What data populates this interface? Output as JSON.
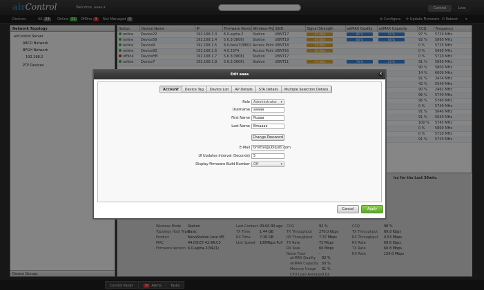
{
  "app": {
    "logo_prefix": "air",
    "logo_suffix": "Control",
    "welcome": "Welcome, aaaa ▾"
  },
  "top_buttons": {
    "control": "Control",
    "live": "Live"
  },
  "status": {
    "devices": "Devices",
    "all_label": "All",
    "all_count": "24",
    "online_label": "Online",
    "online_count": "21",
    "offline_label": "Offline",
    "offline_count": "3",
    "notmanaged_label": "Not Managed",
    "notmanaged_count": "0",
    "configure": "Configure",
    "update_firmware": "Update Firmware",
    "reboot": "Reboot",
    "more": "▾"
  },
  "colors": {
    "online": "#3aaa35",
    "offline": "#c22",
    "accent": "#1d7ab8",
    "apply": "#5ca52a"
  },
  "left": {
    "title": "Network Topology",
    "tree": [
      "airControl Server",
      "ABCD Network",
      "BFGH Network",
      "192.168.2",
      "PTP Devices"
    ],
    "footer": "Device Groups"
  },
  "grid": {
    "columns": [
      "Status",
      "Device Name",
      "IP",
      "Firmware Version",
      "Wireless Mode",
      "SSID",
      "Signal Strength",
      "airMAX Quality",
      "airMAX Capacity",
      "CCQ",
      "Frequency"
    ],
    "rows": [
      [
        "online",
        "Device22",
        "192.168.1.3",
        "6.0-alpha.2",
        "Station",
        "UBNT17",
        "-53 dBm",
        "85 %",
        "52 %",
        "97 %",
        "5720 MHz"
      ],
      [
        "online",
        "Device59",
        "192.168.1.4",
        "5.6.3(3808)",
        "Station",
        "UBNT19",
        "-67 dBm",
        "84 %",
        "86 %",
        "92 %",
        "5860 MHz"
      ],
      [
        "online",
        "DeviceR",
        "192.168.1.5",
        "6.0-beta7(3860)",
        "Access Point",
        "UBNT18",
        "-58 dBm",
        "",
        "",
        "0 %",
        "5725 MHz"
      ],
      [
        "online",
        "Device92",
        "192.168.1.6",
        "4.0.3374",
        "Access Point",
        "UBNT16",
        "-62 dBm",
        "",
        "",
        "0 %",
        "5660 MHz"
      ],
      [
        "offline",
        "DeviceHB",
        "192.168.1.7",
        "5.6.3(3808)",
        "Station",
        "UBNT17",
        "",
        "",
        "",
        "0 %",
        "5720 MHz"
      ],
      [
        "online",
        "Device7",
        "192.168.1.8",
        "5.6.2(3808)",
        "Station",
        "UBNT11",
        "-47 dBm",
        "74 %",
        "52 %",
        "91 %",
        "5860 MHz"
      ]
    ],
    "extra_ccq": [
      "90 %",
      "14 %",
      "91 %",
      "42 %",
      "90 %",
      "96 %",
      "96 %",
      "0 %",
      "91 %",
      "91 %",
      "100 %",
      "0 %",
      "0 %",
      "91 %"
    ],
    "extra_freq": [
      "5800 MHz",
      "6000 MHz",
      "2474 MHz",
      "5540 MHz",
      "2462 MHz",
      "5740 MHz",
      "5740 MHz",
      "5740 MHz",
      "5640 MHz",
      "5640 MHz",
      "5745 MHz",
      "5800 MHz",
      "5720 MHz",
      "5720 MHz"
    ]
  },
  "detail": {
    "chart_title": "ics for the Last 30min.",
    "left_labels": [
      "Wireless Mode",
      "Topology Host Type",
      "Product",
      "MAC",
      "Firmware Version"
    ],
    "left_values": [
      "Station",
      "Basic",
      "NanoStation Loco M5",
      "44:D9:E7:42:9A:C3",
      "6.0-alpha.2(3421)"
    ],
    "mid_labels": [
      "Last Contact",
      "TX Time",
      "RX Time",
      "Link Speed"
    ],
    "mid_values": [
      "00:00:30 ago",
      "1.44 GB",
      "7.36 GB",
      "100Mbps-Full"
    ],
    "r1_labels": [
      "CCQ",
      "TX Throughput",
      "RX Throughput",
      "TX Rate",
      "RX Rate",
      "Noise Floor"
    ],
    "r1_values": [
      "92 %",
      "270.0 Kbps",
      "7.37 Mbps",
      "72 Mbps",
      "60 Mbps",
      "-"
    ],
    "r2_labels": [
      "CCQ",
      "TX Throughput",
      "RX Throughput",
      "RX Rate",
      "TX Rate",
      "RX Rate"
    ],
    "r2_values": [
      "98 %",
      "69.8 Kbps",
      "4.53 Mbps",
      "69.8 Kbps",
      "60.8 Mbps",
      "150.0 Mbps"
    ],
    "quality_labels": [
      "airMAX Quality",
      "airMAX Capacity",
      "Memory Usage",
      "CPU Load Average"
    ],
    "quality_values": [
      "92 %",
      "50 %",
      "31 %",
      "0.02"
    ]
  },
  "bottom": {
    "control_panel": "Control Panel",
    "alerts": "Alerts",
    "alert_count": "36",
    "tasks": "Tasks"
  },
  "dialog": {
    "title": "Edit aaaa",
    "close": "×",
    "tabs": [
      "Account",
      "Device Tag",
      "Device List",
      "AP Details",
      "STA Details",
      "Multiple Selection Details"
    ],
    "role_label": "Role",
    "role_value": "Administrator",
    "username_label": "Username",
    "username_value": "aaaaa",
    "firstname_label": "First Name",
    "firstname_value": "Ruaaa",
    "lastname_label": "Last Name",
    "lastname_value": "Bmaaaa",
    "change_password": "Change Password",
    "email_label": "E-Mail",
    "email_value": "bmittal@ubiquiti.com",
    "ui_interval_label": "UI Updates Interval (Seconds)",
    "ui_interval_value": "5",
    "firmware_label": "Display Firmware Build Number",
    "firmware_value": "Off",
    "cancel": "Cancel",
    "apply": "Apply"
  }
}
